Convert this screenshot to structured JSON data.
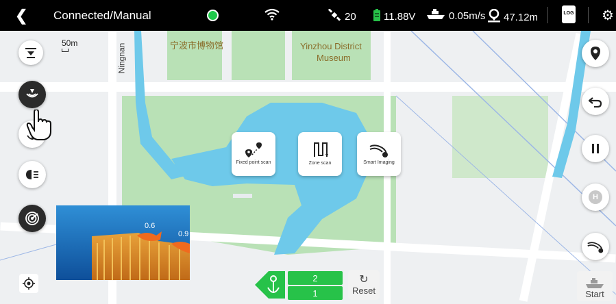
{
  "status": {
    "back_icon": "back-chevron-icon",
    "title": "Connected/Manual",
    "connection_color": "#1fc94a",
    "satellites": "20",
    "battery": "11.88V",
    "speed": "0.05m/s",
    "depth": "47.12m",
    "log_label": "LOG"
  },
  "map": {
    "scale": "50m",
    "road_label": "Ningnan",
    "poi_1": "宁波市博物馆",
    "poi_2_line1": "Yinzhou District",
    "poi_2_line2": "Museum"
  },
  "modes": {
    "fixed_point": "Fixed point scan",
    "zone_scan": "Zone scan",
    "smart_imaging": "Smart Imaging"
  },
  "sonar": {
    "depth_a": "0.6",
    "depth_b": "0.9"
  },
  "controls": {
    "gear_2": "2",
    "gear_1": "1",
    "reset": "Reset",
    "start": "Start",
    "home": "H"
  }
}
